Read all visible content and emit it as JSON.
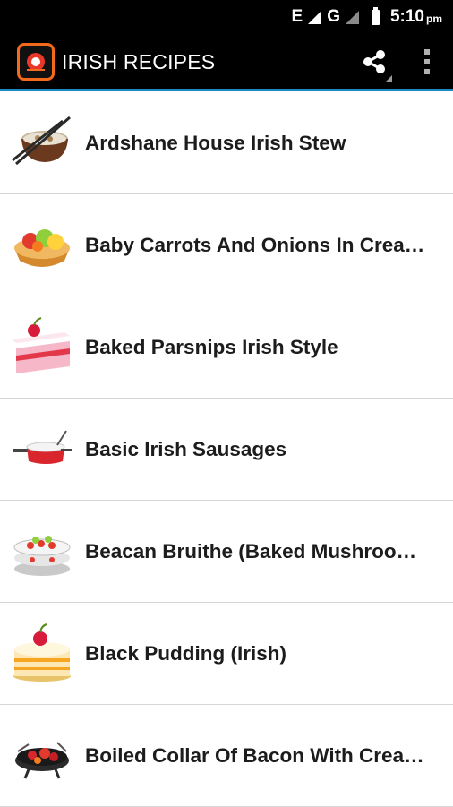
{
  "status_bar": {
    "network": "E",
    "network2": "G",
    "time": "5:10",
    "ampm": "pm"
  },
  "app_bar": {
    "title": "IRISH RECIPES",
    "actions": [
      {
        "icon": "share-icon"
      },
      {
        "icon": "overflow-menu-icon"
      }
    ]
  },
  "colors": {
    "app_bar_bg": "#000000",
    "accent_line": "#1e88c8",
    "logo_accent": "#f36a1c"
  },
  "recipes": [
    {
      "label": "Ardshane House Irish Stew",
      "icon": "stew-bowl-icon"
    },
    {
      "label": "Baby Carrots And Onions In Crea…",
      "icon": "fruit-tart-icon"
    },
    {
      "label": "Baked Parsnips Irish Style",
      "icon": "cake-slice-icon"
    },
    {
      "label": "Basic Irish Sausages",
      "icon": "saucepan-icon"
    },
    {
      "label": "Beacan Bruithe (Baked Mushroo…",
      "icon": "salad-plate-icon"
    },
    {
      "label": "Black Pudding (Irish)",
      "icon": "layer-cake-icon"
    },
    {
      "label": "Boiled Collar Of Bacon With Crea…",
      "icon": "grill-icon"
    }
  ]
}
